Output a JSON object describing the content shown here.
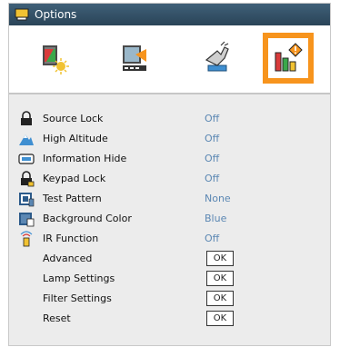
{
  "window": {
    "title": "Options"
  },
  "tabs": [
    {
      "icon": "display-settings-icon"
    },
    {
      "icon": "projector-screen-icon"
    },
    {
      "icon": "hand-setup-icon"
    },
    {
      "icon": "options-chart-icon",
      "selected": true
    }
  ],
  "colors": {
    "accent": "#f7941d",
    "value_text": "#5b87b3",
    "title_bar": "#2f4d63"
  },
  "menu": {
    "items": [
      {
        "label": "Source Lock",
        "value": "Off",
        "icon": "lock-icon"
      },
      {
        "label": "High Altitude",
        "value": "Off",
        "icon": "mountain-icon"
      },
      {
        "label": "Information Hide",
        "value": "Off",
        "icon": "info-hide-icon"
      },
      {
        "label": "Keypad Lock",
        "value": "Off",
        "icon": "keypad-lock-icon"
      },
      {
        "label": "Test Pattern",
        "value": "None",
        "icon": "test-pattern-icon"
      },
      {
        "label": "Background Color",
        "value": "Blue",
        "icon": "background-color-icon"
      },
      {
        "label": "IR Function",
        "value": "Off",
        "icon": "ir-function-icon"
      },
      {
        "label": "Advanced",
        "button": "OK"
      },
      {
        "label": "Lamp Settings",
        "button": "OK"
      },
      {
        "label": "Filter Settings",
        "button": "OK"
      },
      {
        "label": "Reset",
        "button": "OK"
      }
    ]
  }
}
